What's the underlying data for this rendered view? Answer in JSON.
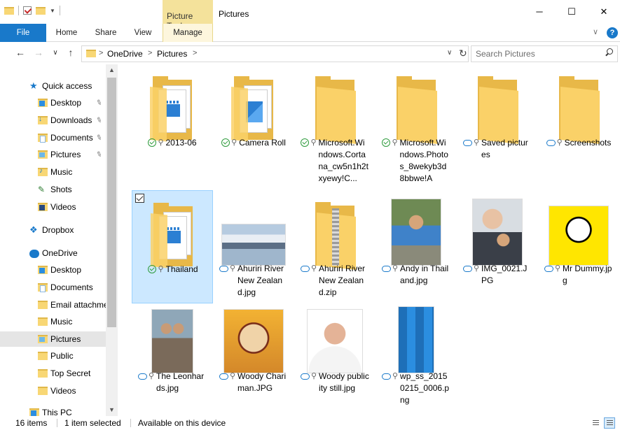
{
  "window": {
    "title": "Pictures",
    "context_group": "Picture Tools",
    "minimize": "─",
    "maximize": "☐",
    "close": "✕"
  },
  "ribbon": {
    "tabs": [
      {
        "label": "File"
      },
      {
        "label": "Home"
      },
      {
        "label": "Share"
      },
      {
        "label": "View"
      },
      {
        "label": "Manage"
      }
    ],
    "expand_glyph": "∨",
    "help_glyph": "?"
  },
  "nav": {
    "back_glyph": "←",
    "forward_glyph": "→",
    "recent_glyph": "∨",
    "up_glyph": "↑",
    "breadcrumbs": [
      "OneDrive",
      "Pictures"
    ],
    "separator": ">",
    "dropdown_glyph": "∨",
    "refresh_glyph": "↻"
  },
  "search": {
    "placeholder": "Search Pictures",
    "value": ""
  },
  "sidebar": {
    "items": [
      {
        "label": "Quick access",
        "icon": "star-icon",
        "indent": 0,
        "pinned": false
      },
      {
        "label": "Desktop",
        "icon": "desktop-folder-icon",
        "indent": 1,
        "pinned": true
      },
      {
        "label": "Downloads",
        "icon": "downloads-folder-icon",
        "indent": 1,
        "pinned": true
      },
      {
        "label": "Documents",
        "icon": "documents-folder-icon",
        "indent": 1,
        "pinned": true
      },
      {
        "label": "Pictures",
        "icon": "pictures-folder-icon",
        "indent": 1,
        "pinned": true
      },
      {
        "label": "Music",
        "icon": "music-folder-icon",
        "indent": 1,
        "pinned": false
      },
      {
        "label": "Shots",
        "icon": "shots-folder-icon",
        "indent": 1,
        "pinned": false
      },
      {
        "label": "Videos",
        "icon": "videos-folder-icon",
        "indent": 1,
        "pinned": false
      },
      {
        "label": "Dropbox",
        "icon": "dropbox-icon",
        "indent": 0,
        "pinned": false
      },
      {
        "label": "OneDrive",
        "icon": "onedrive-cloud-icon",
        "indent": 0,
        "pinned": false
      },
      {
        "label": "Desktop",
        "icon": "desktop-folder-icon",
        "indent": 1,
        "pinned": false
      },
      {
        "label": "Documents",
        "icon": "documents-folder-icon",
        "indent": 1,
        "pinned": false
      },
      {
        "label": "Email attachme",
        "icon": "folder-icon",
        "indent": 1,
        "pinned": false
      },
      {
        "label": "Music",
        "icon": "folder-icon",
        "indent": 1,
        "pinned": false
      },
      {
        "label": "Pictures",
        "icon": "pictures-folder-icon",
        "indent": 1,
        "pinned": false,
        "selected": true
      },
      {
        "label": "Public",
        "icon": "folder-icon",
        "indent": 1,
        "pinned": false
      },
      {
        "label": "Top Secret",
        "icon": "folder-icon",
        "indent": 1,
        "pinned": false
      },
      {
        "label": "Videos",
        "icon": "folder-icon",
        "indent": 1,
        "pinned": false
      },
      {
        "label": "This PC",
        "icon": "pc-icon",
        "indent": 0,
        "pinned": false
      }
    ],
    "pin_glyph": "📌"
  },
  "files": [
    {
      "name": "2013-06",
      "kind": "folder-video",
      "status": "synced"
    },
    {
      "name": "Camera Roll",
      "kind": "folder-photo",
      "status": "synced"
    },
    {
      "name": "Microsoft.Windows.Cortana_cw5n1h2txyewy!C...",
      "kind": "folder",
      "status": "synced"
    },
    {
      "name": "Microsoft.Windows.Photos_8wekyb3d8bbwe!A",
      "kind": "folder",
      "status": "synced"
    },
    {
      "name": "Saved pictures",
      "kind": "folder",
      "status": "cloud"
    },
    {
      "name": "Screenshots",
      "kind": "folder",
      "status": "cloud"
    },
    {
      "name": "Thailand",
      "kind": "folder-video",
      "status": "synced",
      "selected": true
    },
    {
      "name": "Ahuriri River New Zealand.jpg",
      "kind": "photo-lake",
      "status": "cloud"
    },
    {
      "name": "Ahuriri River New Zealand.zip",
      "kind": "zip",
      "status": "cloud"
    },
    {
      "name": "Andy in Thailand.jpg",
      "kind": "photo-boy",
      "status": "cloud"
    },
    {
      "name": "IMG_0021.JPG",
      "kind": "photo-family",
      "status": "cloud"
    },
    {
      "name": "Mr Dummy.jpg",
      "kind": "photo-dummy",
      "status": "cloud"
    },
    {
      "name": "The Leonhards.jpg",
      "kind": "photo-people",
      "status": "cloud"
    },
    {
      "name": "Woody Chariman.JPG",
      "kind": "photo-cartoon",
      "status": "cloud"
    },
    {
      "name": "Woody publicity still.jpg",
      "kind": "photo-portrait",
      "status": "cloud"
    },
    {
      "name": "wp_ss_20150215_0006.png",
      "kind": "photo-phone",
      "status": "cloud"
    }
  ],
  "status": {
    "count": "16 items",
    "selected": "1 item selected",
    "availability": "Available on this device"
  },
  "colors": {
    "accent": "#1979ca",
    "selection": "#cce8ff",
    "context_tab": "#f4e29b",
    "folder": "#fad168"
  }
}
